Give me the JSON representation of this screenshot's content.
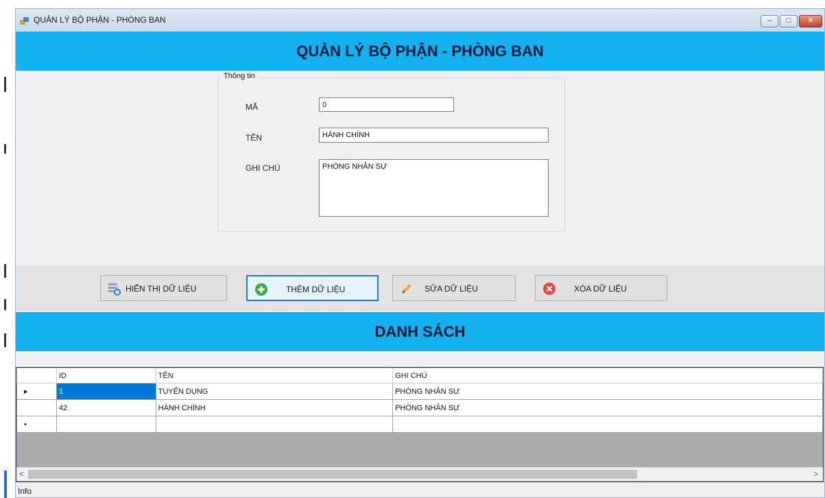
{
  "window": {
    "title": "QUẢN LÝ BỘ PHẬN - PHÒNG BAN",
    "controls": {
      "minimize": "–",
      "maximize": "□",
      "close": "✕"
    }
  },
  "header": {
    "title": "QUẢN LÝ BỘ PHẬN - PHÒNG BAN"
  },
  "form": {
    "group_label": "Thông tin",
    "ma_label": "MÃ",
    "ma_value": "0",
    "ten_label": "TÊN",
    "ten_value": "HÀNH CHÍNH",
    "ghichu_label": "GHI CHÚ",
    "ghichu_value": "PHÒNG NHÂN SỰ"
  },
  "buttons": {
    "show": "HIỂN THỊ DỮ LIỆU",
    "add": "THÊM DỮ LIỆU",
    "edit": "SỬA DỮ LIỆU",
    "delete": "XÓA DỮ LIỆU"
  },
  "list": {
    "title": "DANH SÁCH",
    "columns": [
      "ID",
      "TÊN",
      "GHI CHÚ"
    ],
    "rows": [
      {
        "marker": "▸",
        "id": "1",
        "ten": "TUYỂN DỤNG",
        "ghichu": "PHÒNG NHÂN SỰ"
      },
      {
        "marker": "",
        "id": "42",
        "ten": "HÀNH CHÍNH",
        "ghichu": "PHÒNG NHÂN SỰ"
      },
      {
        "marker": "•",
        "id": "",
        "ten": "",
        "ghichu": ""
      }
    ]
  },
  "status": {
    "text": "Info"
  },
  "icons": {
    "app": "app-icon",
    "show": "refresh-data-icon",
    "add": "plus-circle-icon",
    "edit": "pencil-icon",
    "delete": "x-circle-icon"
  },
  "colors": {
    "header_band": "#14b1f0",
    "selected_cell": "#0078d7",
    "focus_border": "#1d78d6"
  }
}
